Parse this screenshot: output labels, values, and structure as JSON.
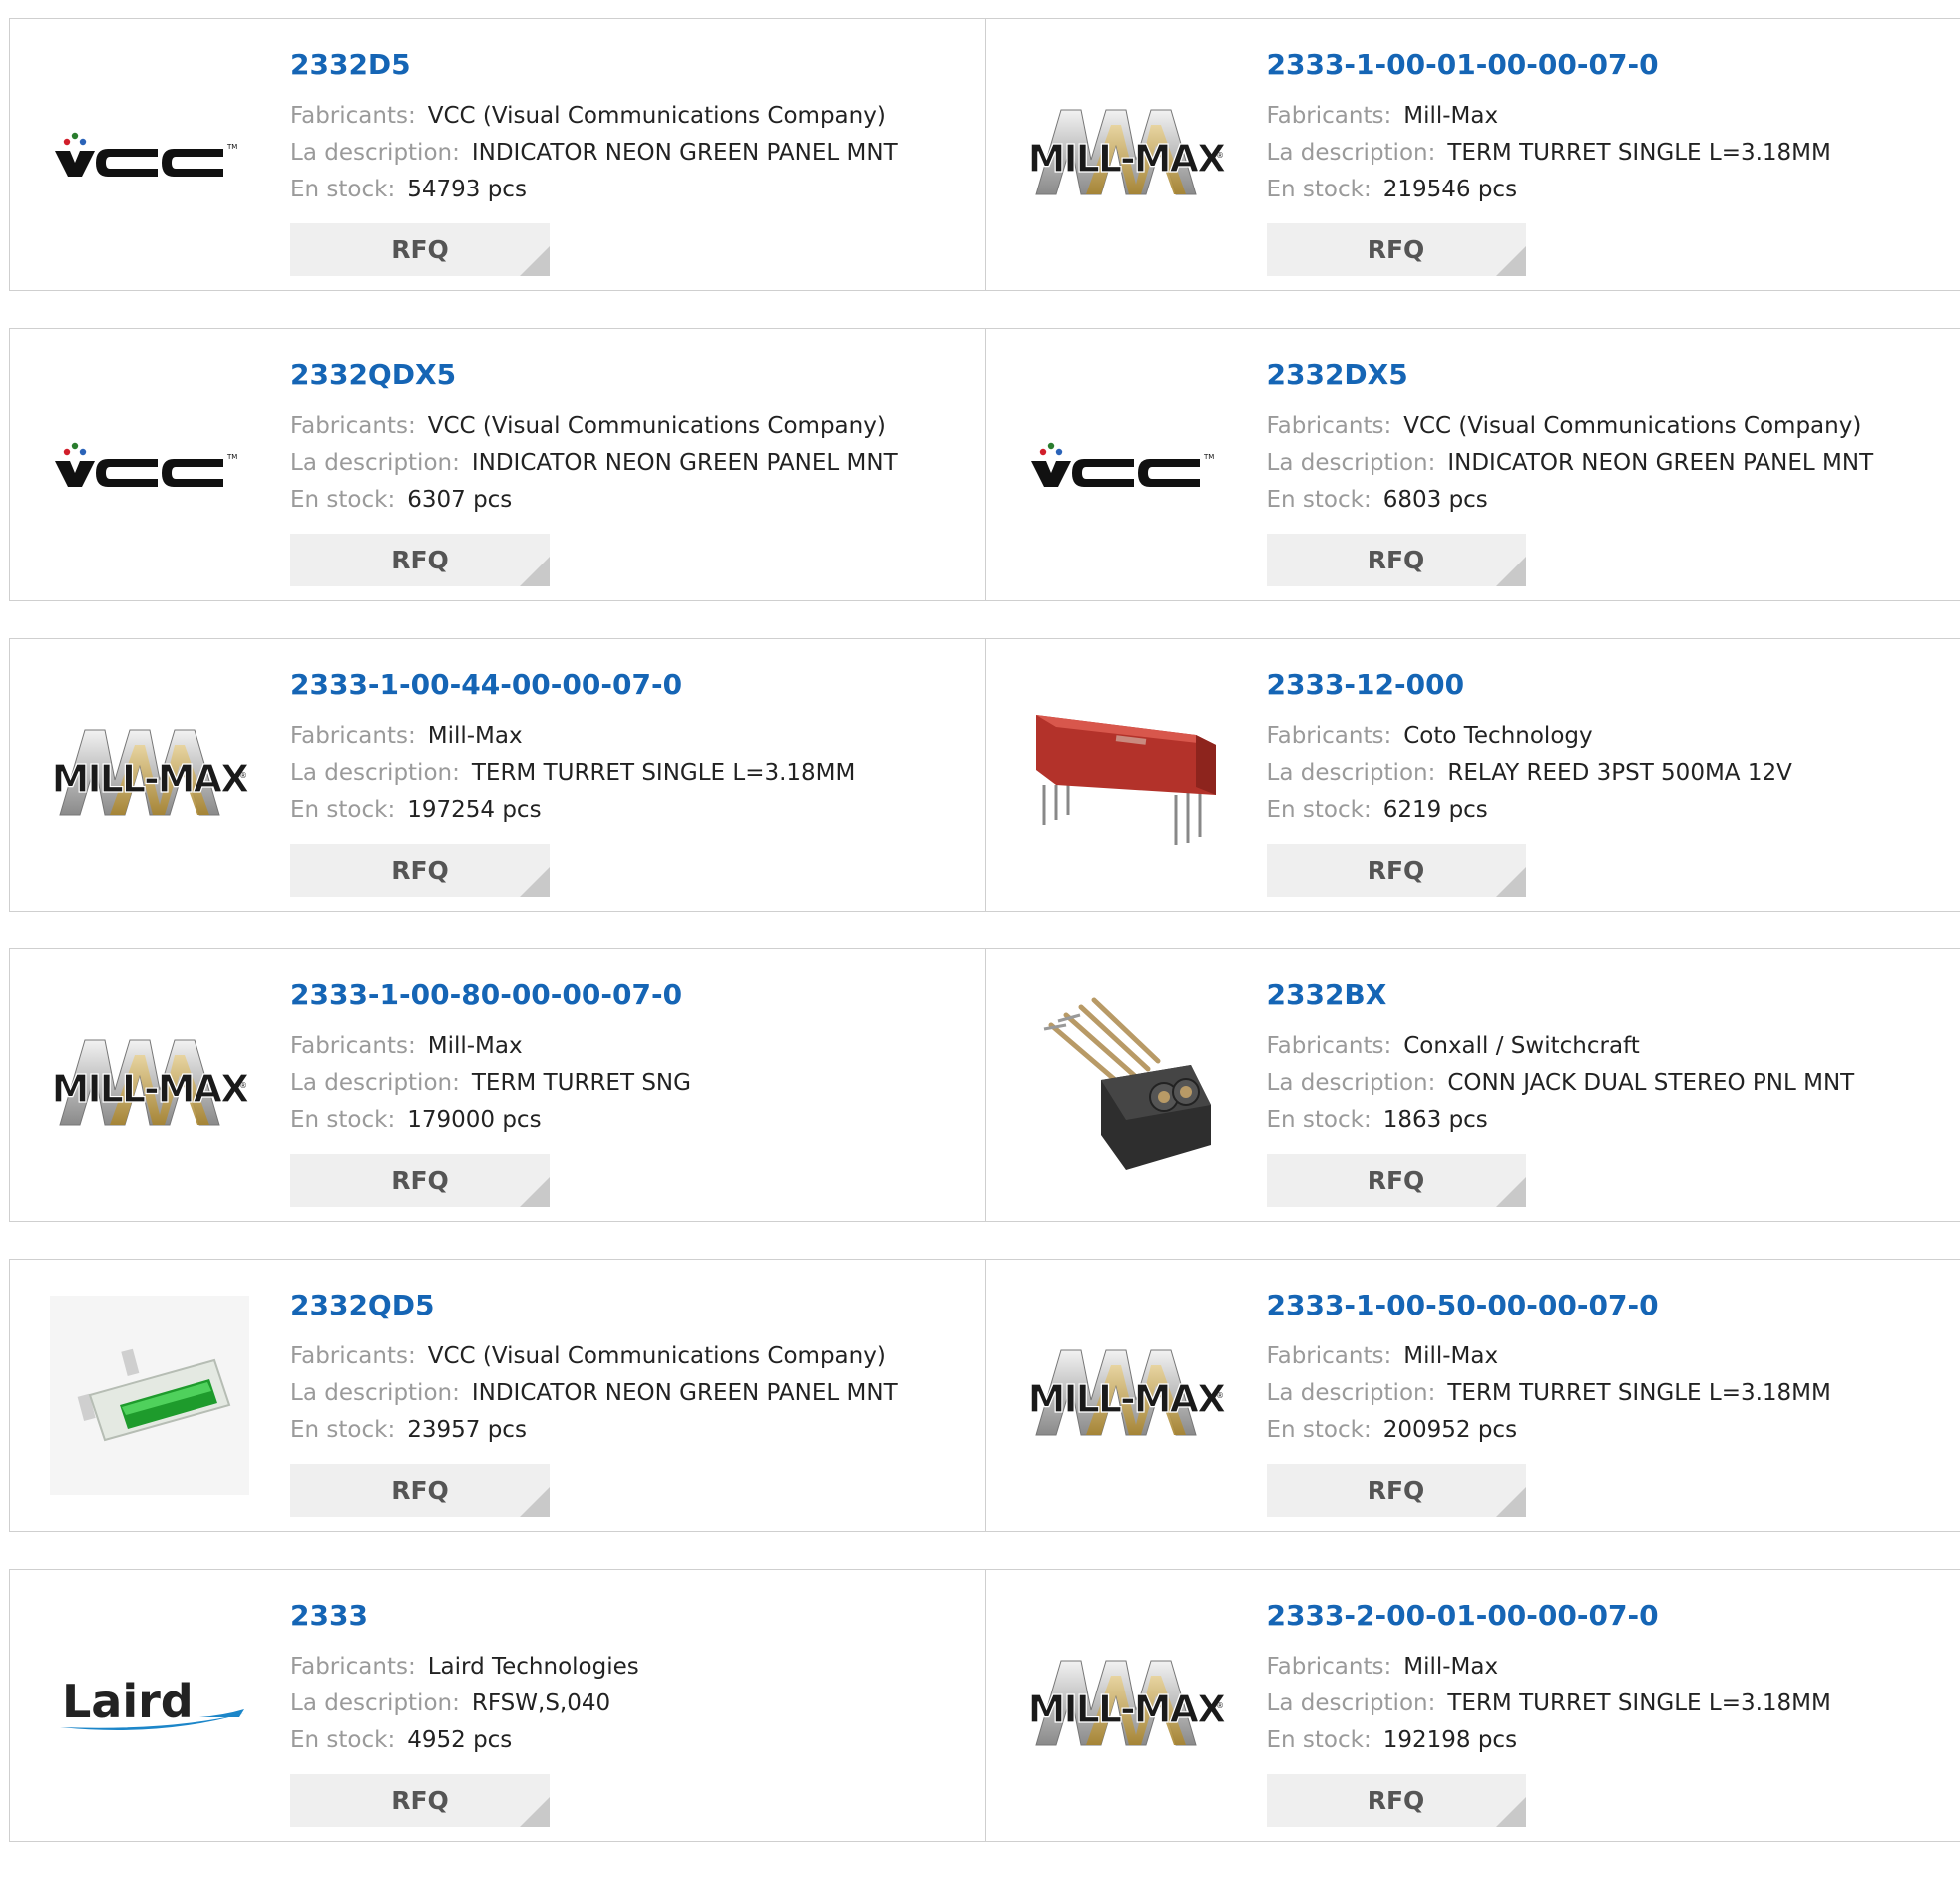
{
  "labels": {
    "manufacturer": "Fabricants:",
    "description": "La description:",
    "stock": "En stock:",
    "rfq": "RFQ"
  },
  "colors": {
    "part_link": "#1565b5",
    "label": "#9a9a9a",
    "rfq_bg": "#efefef"
  },
  "products": [
    {
      "part": "2332D5",
      "manufacturer": "VCC (Visual Communications Company)",
      "description": "INDICATOR NEON GREEN PANEL MNT",
      "stock": "54793 pcs",
      "image": "vcc-logo"
    },
    {
      "part": "2333-1-00-01-00-00-07-0",
      "manufacturer": "Mill-Max",
      "description": "TERM TURRET SINGLE L=3.18MM",
      "stock": "219546 pcs",
      "image": "millmax-logo"
    },
    {
      "part": "2332QDX5",
      "manufacturer": "VCC (Visual Communications Company)",
      "description": "INDICATOR NEON GREEN PANEL MNT",
      "stock": "6307 pcs",
      "image": "vcc-logo"
    },
    {
      "part": "2332DX5",
      "manufacturer": "VCC (Visual Communications Company)",
      "description": "INDICATOR NEON GREEN PANEL MNT",
      "stock": "6803 pcs",
      "image": "vcc-logo"
    },
    {
      "part": "2333-1-00-44-00-00-07-0",
      "manufacturer": "Mill-Max",
      "description": "TERM TURRET SINGLE L=3.18MM",
      "stock": "197254 pcs",
      "image": "millmax-logo"
    },
    {
      "part": "2333-12-000",
      "manufacturer": "Coto Technology",
      "description": "RELAY REED 3PST 500MA 12V",
      "stock": "6219 pcs",
      "image": "relay-photo"
    },
    {
      "part": "2333-1-00-80-00-00-07-0",
      "manufacturer": "Mill-Max",
      "description": "TERM TURRET SNG",
      "stock": "179000 pcs",
      "image": "millmax-logo"
    },
    {
      "part": "2332BX",
      "manufacturer": "Conxall / Switchcraft",
      "description": "CONN JACK DUAL STEREO PNL MNT",
      "stock": "1863 pcs",
      "image": "jack-photo"
    },
    {
      "part": "2332QD5",
      "manufacturer": "VCC (Visual Communications Company)",
      "description": "INDICATOR NEON GREEN PANEL MNT",
      "stock": "23957 pcs",
      "image": "indicator-photo"
    },
    {
      "part": "2333-1-00-50-00-00-07-0",
      "manufacturer": "Mill-Max",
      "description": "TERM TURRET SINGLE L=3.18MM",
      "stock": "200952 pcs",
      "image": "millmax-logo"
    },
    {
      "part": "2333",
      "manufacturer": "Laird Technologies",
      "description": "RFSW,S,040",
      "stock": "4952 pcs",
      "image": "laird-logo"
    },
    {
      "part": "2333-2-00-01-00-00-07-0",
      "manufacturer": "Mill-Max",
      "description": "TERM TURRET SINGLE L=3.18MM",
      "stock": "192198 pcs",
      "image": "millmax-logo"
    }
  ]
}
